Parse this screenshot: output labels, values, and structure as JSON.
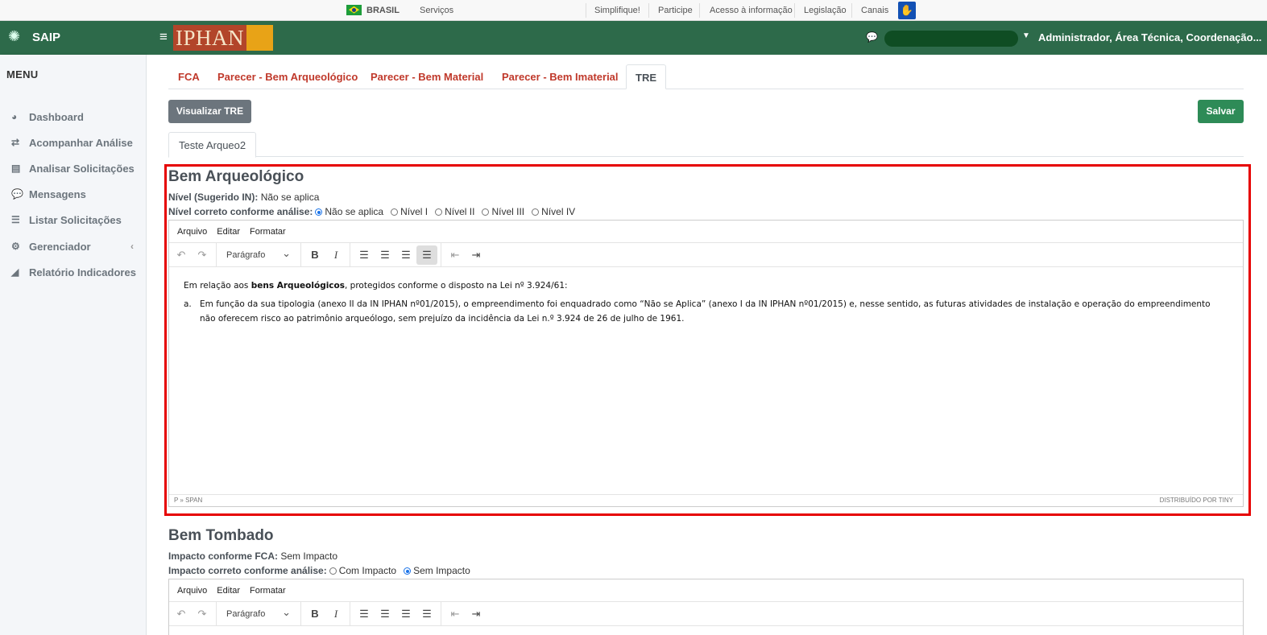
{
  "govbar": {
    "country": "BRASIL",
    "services": "Serviços",
    "links": [
      "Simplifique!",
      "Participe",
      "Acesso à informação",
      "Legislação",
      "Canais"
    ]
  },
  "header": {
    "app_name": "SAIP",
    "logo_text": "IPHAN",
    "user_label": "Administrador, Área Técnica, Coordenação..."
  },
  "sidebar": {
    "title": "MENU",
    "items": [
      {
        "label": "Dashboard",
        "icon": "dashboard-icon"
      },
      {
        "label": "Acompanhar Análise",
        "icon": "exchange-icon"
      },
      {
        "label": "Analisar Solicitações",
        "icon": "book-icon"
      },
      {
        "label": "Mensagens",
        "icon": "comments-icon"
      },
      {
        "label": "Listar Solicitações",
        "icon": "list-icon"
      },
      {
        "label": "Gerenciador",
        "icon": "gears-icon"
      },
      {
        "label": "Relatório Indicadores",
        "icon": "area-chart-icon"
      }
    ]
  },
  "tabs": [
    "FCA",
    "Parecer - Bem Arqueológico",
    "Parecer - Bem Material",
    "Parecer - Bem Imaterial",
    "TRE"
  ],
  "active_tab": "TRE",
  "buttons": {
    "visualizar": "Visualizar TRE",
    "salvar": "Salvar"
  },
  "subtab": "Teste Arqueo2",
  "editor_menu": [
    "Arquivo",
    "Editar",
    "Formatar"
  ],
  "editor_format": "Parágrafo",
  "section1": {
    "title": "Bem Arqueológico",
    "nivel_label": "Nível (Sugerido IN):",
    "nivel_value": "Não se aplica",
    "correto_label": "Nível correto conforme análise:",
    "options": [
      "Não se aplica",
      "Nível I",
      "Nível II",
      "Nível III",
      "Nível IV"
    ],
    "selected": "Não se aplica",
    "body_intro_pre": "Em relação aos ",
    "body_intro_bold": "bens Arqueológicos",
    "body_intro_post": ", protegidos conforme o disposto na Lei nº 3.924/61:",
    "item_num": "a.",
    "item_text": "Em função da sua tipologia (anexo II da IN IPHAN nº01/2015), o empreendimento foi enquadrado como “Não se Aplica” (anexo I da IN IPHAN nº01/2015) e, nesse sentido, as futuras atividades de instalação e operação do empreendimento não oferecem risco ao patrimônio arqueólogo, sem prejuízo da incidência da Lei n.º 3.924 de 26 de julho de 1961.",
    "status_path": "P » SPAN",
    "status_brand": "DISTRIBUÍDO POR TINY"
  },
  "section2": {
    "title": "Bem Tombado",
    "impacto_label": "Impacto conforme FCA:",
    "impacto_value": "Sem Impacto",
    "correto_label": "Impacto correto conforme análise:",
    "options": [
      "Com Impacto",
      "Sem Impacto"
    ],
    "selected": "Sem Impacto"
  },
  "colors": {
    "brand_green": "#2d6a4a",
    "tab_red": "#c0392b",
    "save_green": "#2e8b57",
    "highlight": "#e60000"
  }
}
